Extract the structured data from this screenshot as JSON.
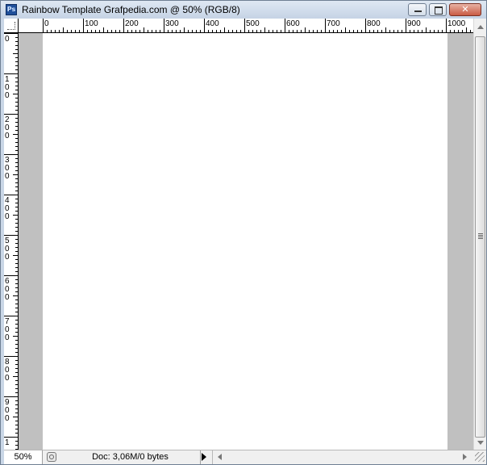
{
  "window": {
    "title": "Rainbow Template Grafpedia.com @ 50% (RGB/8)",
    "app_icon": "Ps"
  },
  "rulers": {
    "horizontal_labels": [
      "0",
      "100",
      "200",
      "300",
      "400",
      "500",
      "600",
      "700",
      "800",
      "900",
      "1000"
    ],
    "vertical_labels": [
      "0",
      "100",
      "200",
      "300",
      "400",
      "500",
      "600",
      "700",
      "800",
      "900",
      "1"
    ]
  },
  "status": {
    "zoom": "50%",
    "doc_info": "Doc: 3,06M/0 bytes"
  },
  "colors": {
    "workspace": "#c0c0c0",
    "canvas": "#ffffff",
    "titlebar": "#c5d3e5"
  },
  "icons": [
    "photoshop-app-icon",
    "minimize-icon",
    "maximize-icon",
    "close-icon",
    "ruler-origin-icon",
    "status-info-icon",
    "status-menu-arrow-icon",
    "scroll-up-icon",
    "scroll-down-icon",
    "scroll-left-icon",
    "scroll-right-icon",
    "resize-grip-icon"
  ]
}
